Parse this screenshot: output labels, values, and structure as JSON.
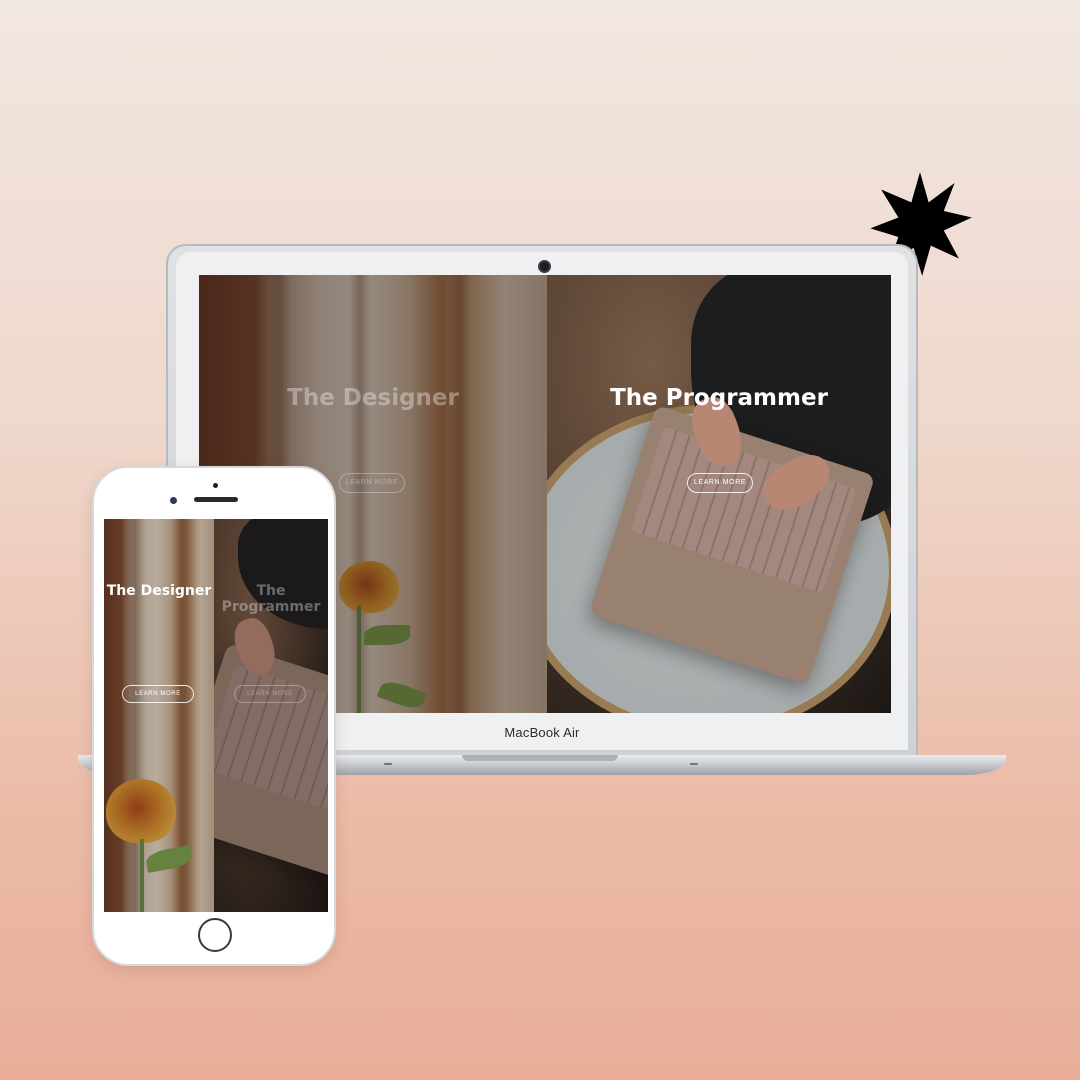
{
  "laptop": {
    "brand_name": "MacBook Air",
    "site": {
      "panels": [
        {
          "title": "The Designer",
          "button": "LEARN MORE"
        },
        {
          "title": "The Programmer",
          "button": "LEARN MORE"
        }
      ]
    }
  },
  "phone": {
    "site": {
      "panels": [
        {
          "title": "The Designer",
          "button": "LEARN MORE"
        },
        {
          "title": "The Programmer",
          "button": "LEARN MORE"
        }
      ]
    }
  },
  "decoration": {
    "icon": "starburst-icon",
    "color": "#000000"
  }
}
